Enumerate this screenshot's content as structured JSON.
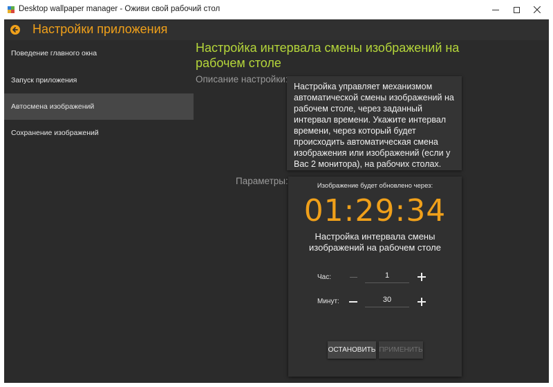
{
  "window": {
    "title": "Desktop wallpaper manager - Оживи свой рабочий стол",
    "controls": [
      "minimize-icon",
      "maximize-icon",
      "close-icon"
    ]
  },
  "header": {
    "back_icon": "arrow-left-icon",
    "title": "Настройки приложения"
  },
  "sidebar": {
    "items": [
      {
        "label": "Поведение главного окна",
        "active": false
      },
      {
        "label": "Запуск приложения",
        "active": false
      },
      {
        "label": "Автосмена изображений",
        "active": true
      },
      {
        "label": "Сохранение изображений",
        "active": false
      }
    ]
  },
  "main": {
    "title": "Настройка интервала смены изображений на рабочем столе",
    "description_label": "Описание настройки:",
    "description_text": "Настройка управляет механизмом автоматической смены изображений на рабочем столе, через заданный интервал времени. Укажите интервал времени, через который будет происходить автоматическая смена изображения или изображений (если у Вас 2 монитора), на рабочих столах.",
    "params_label": "Параметры:",
    "panel": {
      "countdown_caption": "Изображение будет обновлено через:",
      "countdown": "01:29:34",
      "caption": "Настройка интервала смены изображений на рабочем столе",
      "hours": {
        "label": "Час:",
        "value": "1"
      },
      "minutes": {
        "label": "Минут:",
        "value": "30"
      },
      "stop_button": "ОСТАНОВИТЬ",
      "apply_button": "ПРИМЕНИТЬ"
    }
  },
  "colors": {
    "accent_orange": "#f0a01a",
    "accent_green": "#b5d63a",
    "background": "#2b2b2b",
    "active_item": "#474747"
  }
}
